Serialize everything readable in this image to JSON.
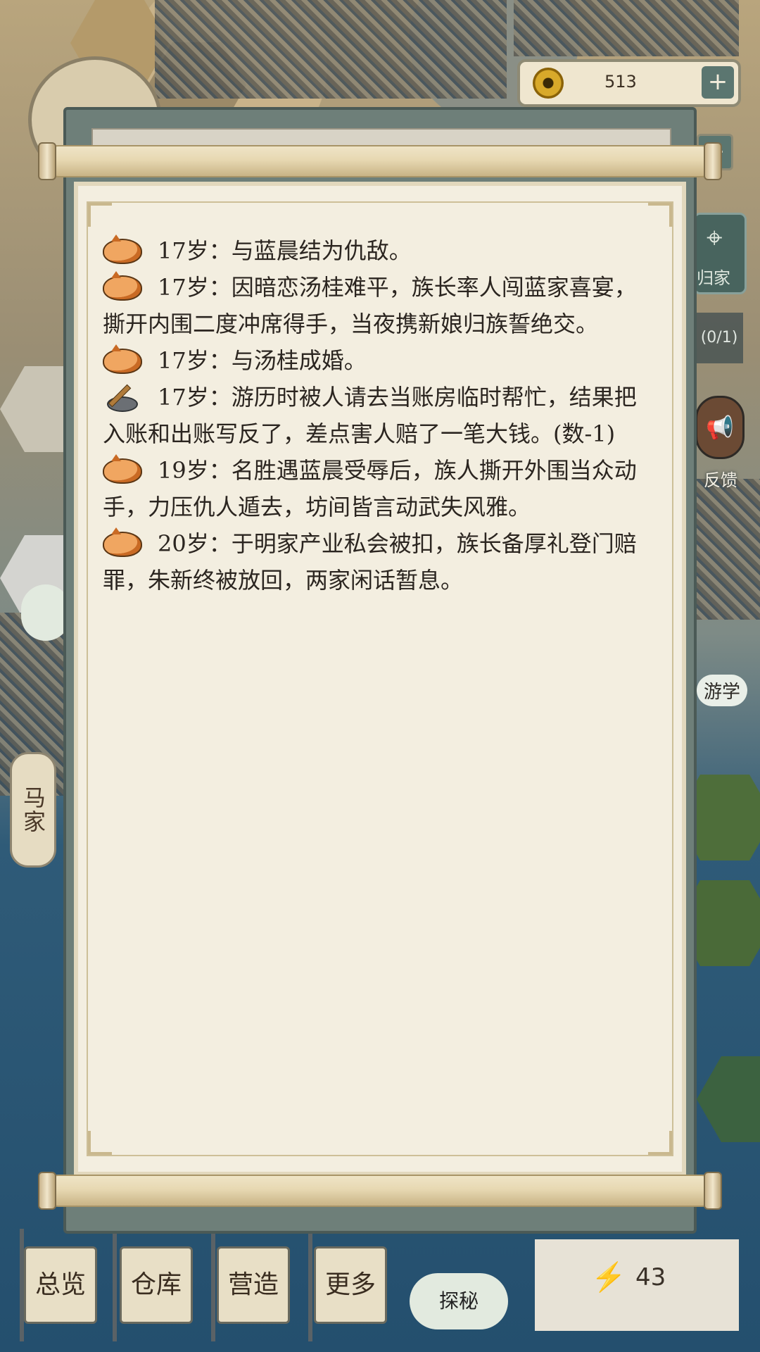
{
  "hud": {
    "coins": "513",
    "coin_plus": "+",
    "second_plus": "+",
    "home_label": "归家",
    "quest_count": "(0/1)",
    "feedback_label": "反馈",
    "travel_label": "游学",
    "left_tab_label": "马家",
    "explore_label": "探秘",
    "energy": "43"
  },
  "bottom_nav": [
    {
      "label": "总览"
    },
    {
      "label": "仓库"
    },
    {
      "label": "营造"
    },
    {
      "label": "更多"
    }
  ],
  "colors": {
    "accent_teal": "#5b7670",
    "paper": "#f3eee0",
    "text": "#2b2520"
  },
  "log": [
    {
      "icon": "fox-icon",
      "text": "17岁：与蓝晨结为仇敌。"
    },
    {
      "icon": "fox-icon",
      "text": "17岁：因暗恋汤桂难平，族长率人闯蓝家喜宴，撕开内围二度冲席得手，当夜携新娘归族誓绝交。"
    },
    {
      "icon": "fox-icon",
      "text": "17岁：与汤桂成婚。"
    },
    {
      "icon": "brush-inkstone-icon",
      "text": "17岁：游历时被人请去当账房临时帮忙，结果把入账和出账写反了，差点害人赔了一笔大钱。(数-1)"
    },
    {
      "icon": "fox-icon",
      "text": "19岁：名胜遇蓝晨受辱后，族人撕开外围当众动手，力压仇人遁去，坊间皆言动武失风雅。"
    },
    {
      "icon": "fox-icon",
      "text": "20岁：于明家产业私会被扣，族长备厚礼登门赔罪，朱新终被放回，两家闲话暂息。"
    }
  ]
}
